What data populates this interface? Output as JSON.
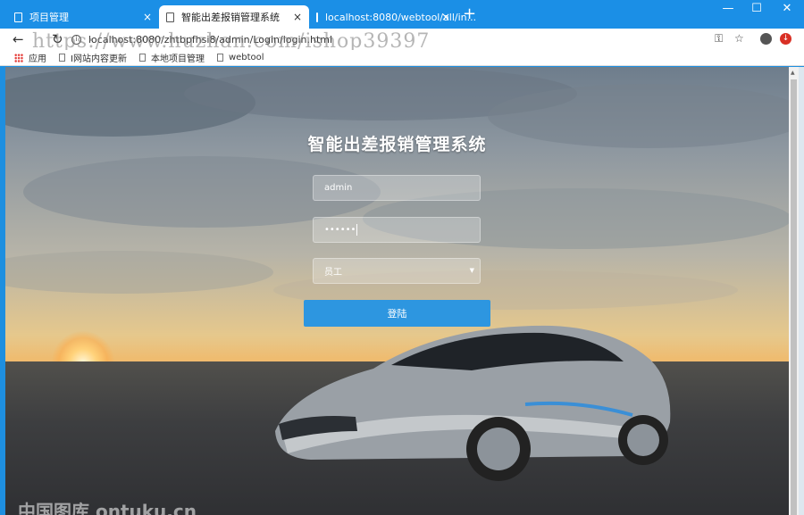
{
  "browser": {
    "tabs": [
      {
        "label": "项目管理"
      },
      {
        "label": "智能出差报销管理系统"
      },
      {
        "label": "localhost:8080/webtool/all/in..."
      }
    ],
    "url": "localhost:8080/zhtbpfhsi8/admin/Login/login.html",
    "watermark": "https://www.huzhan.com/ishop39397",
    "bookmarks": [
      {
        "label": "应用"
      },
      {
        "label": "I网站内容更新"
      },
      {
        "label": "本地项目管理"
      },
      {
        "label": "webtool"
      }
    ],
    "window_controls": {
      "minimize": "—",
      "maximize": "☐",
      "close": "✕"
    },
    "new_tab": "+",
    "tab_close": "×"
  },
  "login": {
    "title": "智能出差报销管理系统",
    "username_value": "admin",
    "password_value": "••••••",
    "role_selected": "员工",
    "submit_label": "登陆"
  },
  "footer_watermark": "中国图库 ontuku.cn",
  "colors": {
    "titlebar": "#1b8fe6",
    "login_button": "#2d96e0"
  }
}
